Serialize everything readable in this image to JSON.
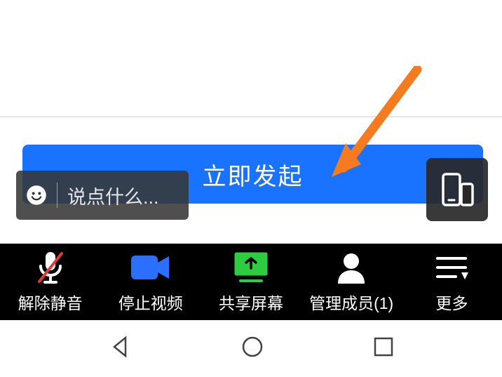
{
  "start_button": {
    "label": "立即发起"
  },
  "chat": {
    "placeholder": "说点什么..."
  },
  "toolbar": {
    "unmute": {
      "label": "解除静音"
    },
    "stop_video": {
      "label": "停止视频"
    },
    "share_screen": {
      "label": "共享屏幕"
    },
    "manage_members": {
      "label": "管理成员(1)"
    },
    "more": {
      "label": "更多"
    }
  },
  "annotation": {
    "arrow_color": "#f47b20"
  }
}
